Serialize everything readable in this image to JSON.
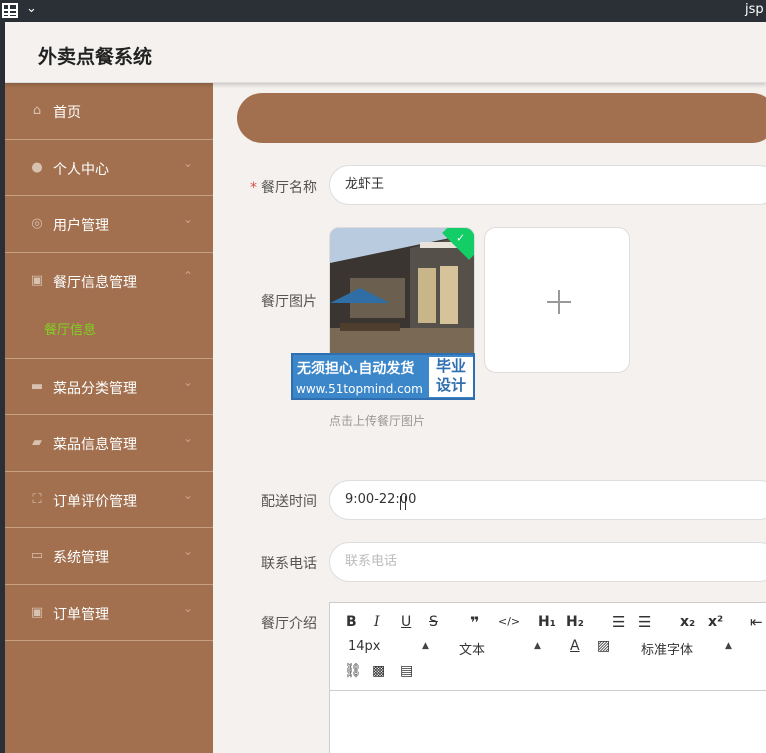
{
  "os": {
    "url_fragment": "jsp"
  },
  "app": {
    "title": "外卖点餐系统"
  },
  "sidebar": {
    "items": [
      {
        "label": "首页",
        "icon": "home-icon"
      },
      {
        "label": "个人中心",
        "icon": "user-icon"
      },
      {
        "label": "用户管理",
        "icon": "users-icon"
      },
      {
        "label": "餐厅信息管理",
        "icon": "clipboard-icon",
        "sub": "餐厅信息"
      },
      {
        "label": "菜品分类管理",
        "icon": "chat-icon"
      },
      {
        "label": "菜品信息管理",
        "icon": "briefcase-icon"
      },
      {
        "label": "订单评价管理",
        "icon": "frame-icon"
      },
      {
        "label": "系统管理",
        "icon": "monitor-icon"
      },
      {
        "label": "订单管理",
        "icon": "clipboard-icon"
      }
    ]
  },
  "form": {
    "name_label": "餐厅名称",
    "name_value": "龙虾王",
    "image_label": "餐厅图片",
    "image_hint": "点击上传餐厅图片",
    "time_label": "配送时间",
    "time_value": "9:00-22:00",
    "phone_label": "联系电话",
    "phone_placeholder": "联系电话",
    "intro_label": "餐厅介绍"
  },
  "watermark": {
    "line1": "无须担心.自动发货",
    "line2": "www.51topmind.com",
    "tag1": "毕业",
    "tag2": "设计"
  },
  "editor": {
    "font_size": "14px",
    "text_type": "文本",
    "font_family": "标准字体",
    "h1": "H₁",
    "h2": "H₂",
    "sub": "x₂",
    "sup": "x²"
  },
  "colors": {
    "sidebar": "#a2704f",
    "active_sub": "#7ed321"
  }
}
